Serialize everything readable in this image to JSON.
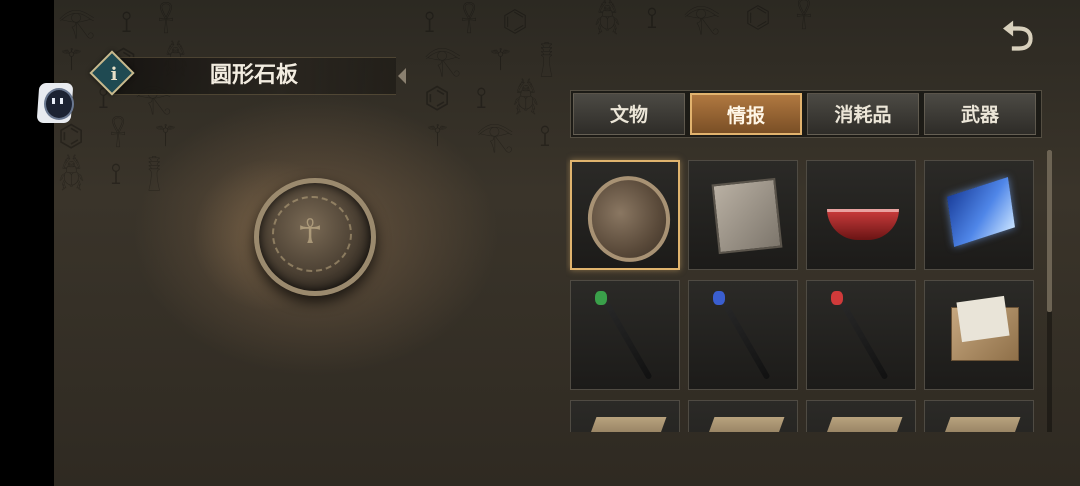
{
  "header": {
    "info_icon": "i",
    "item_name": "圆形石板"
  },
  "nav": {
    "back_icon": "back-arrow-icon"
  },
  "tabs": [
    {
      "label": "文物",
      "active": false
    },
    {
      "label": "情报",
      "active": true
    },
    {
      "label": "消耗品",
      "active": false
    },
    {
      "label": "武器",
      "active": false
    }
  ],
  "inventory": {
    "rows": [
      [
        "round-stone-tablet",
        "carved-stone-slab",
        "red-bowl",
        "blue-map"
      ],
      [
        "green-gem-staff",
        "blue-gem-staff",
        "red-gem-staff",
        "letter-envelope"
      ],
      [
        "partial-item",
        "partial-item",
        "partial-item",
        "partial-item"
      ]
    ],
    "selected_index": 0
  },
  "colors": {
    "active_tab": "#b07840",
    "selected_border": "#e0b46e"
  }
}
